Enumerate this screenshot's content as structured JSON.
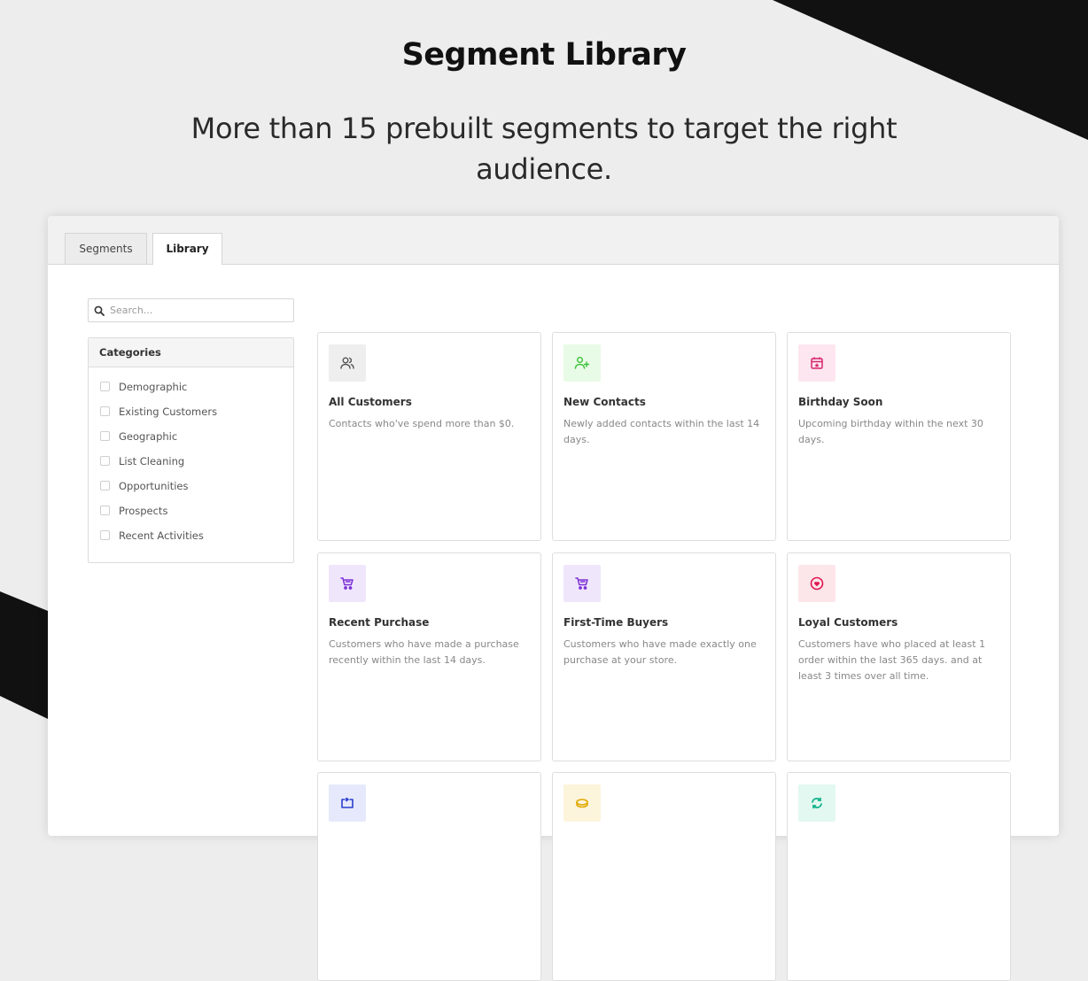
{
  "hero": {
    "title": "Segment Library",
    "subtitle": "More than 15 prebuilt segments to target the right audience."
  },
  "tabs": [
    {
      "label": "Segments",
      "active": false
    },
    {
      "label": "Library",
      "active": true
    }
  ],
  "search": {
    "placeholder": "Search..."
  },
  "categories": {
    "heading": "Categories",
    "items": [
      "Demographic",
      "Existing Customers",
      "Geographic",
      "List Cleaning",
      "Opportunities",
      "Prospects",
      "Recent Activities"
    ]
  },
  "cards": [
    {
      "title": "All Customers",
      "description": "Contacts who've spend more than $0.",
      "icon": "users-icon",
      "icon_color": "#555555",
      "icon_bg": "#eeeeee"
    },
    {
      "title": "New Contacts",
      "description": "Newly added contacts within the last 14 days.",
      "icon": "user-plus-icon",
      "icon_color": "#3cc13b",
      "icon_bg": "#e8fbe6"
    },
    {
      "title": "Birthday Soon",
      "description": "Upcoming birthday within the next 30 days.",
      "icon": "calendar-star-icon",
      "icon_color": "#d6246e",
      "icon_bg": "#fde6ef"
    },
    {
      "title": "Recent Purchase",
      "description": "Customers who have made a purchase recently within the last 14 days.",
      "icon": "cart-icon",
      "icon_color": "#7a2fd6",
      "icon_bg": "#efe6fc"
    },
    {
      "title": "First-Time Buyers",
      "description": "Customers who have made exactly one purchase at your store.",
      "icon": "cart-icon",
      "icon_color": "#7a2fd6",
      "icon_bg": "#efe6fc"
    },
    {
      "title": "Loyal Customers",
      "description": "Customers have who placed at least 1 order within the last 365 days. and at least 3 times over all time.",
      "icon": "heart-circle-icon",
      "icon_color": "#e0174f",
      "icon_bg": "#fde6ea"
    },
    {
      "title": "",
      "description": "",
      "icon": "repeat-box-icon",
      "icon_color": "#2a3fd0",
      "icon_bg": "#e6e9fb"
    },
    {
      "title": "",
      "description": "",
      "icon": "coins-icon",
      "icon_color": "#e0a800",
      "icon_bg": "#fdf4dc"
    },
    {
      "title": "",
      "description": "",
      "icon": "refresh-icon",
      "icon_color": "#14b38a",
      "icon_bg": "#e2f8f1"
    }
  ]
}
